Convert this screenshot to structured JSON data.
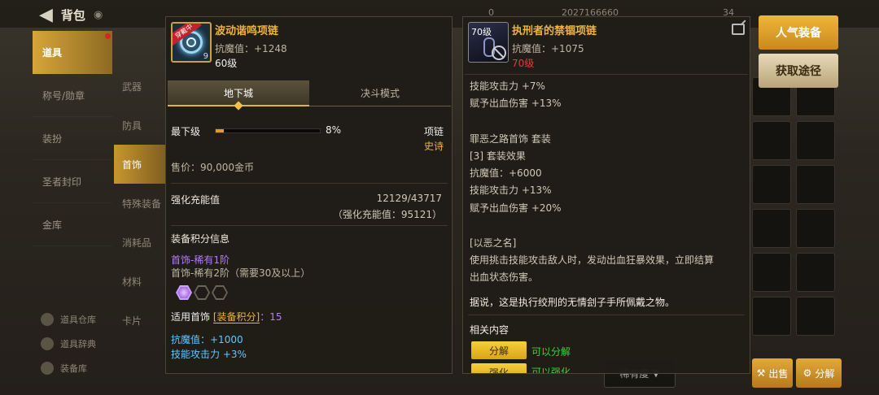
{
  "header": {
    "title": "背包",
    "stats": [
      "0",
      "2027166660",
      "34"
    ]
  },
  "leftnav": {
    "items": [
      {
        "label": "道具",
        "active": true
      },
      {
        "label": "称号/勋章",
        "active": false
      },
      {
        "label": "装扮",
        "active": false
      },
      {
        "label": "圣者封印",
        "active": false
      },
      {
        "label": "金库",
        "active": false
      }
    ]
  },
  "subnav": {
    "items": [
      {
        "label": "武器",
        "active": false
      },
      {
        "label": "防具",
        "active": false
      },
      {
        "label": "首饰",
        "active": true
      },
      {
        "label": "特殊装备",
        "active": false
      },
      {
        "label": "消耗品",
        "active": false
      },
      {
        "label": "材料",
        "active": false
      },
      {
        "label": "卡片",
        "active": false
      }
    ]
  },
  "bottom_left": [
    "道具仓库",
    "道具辞典",
    "装备库"
  ],
  "bottom_buttons": {
    "sell": "出售",
    "disassemble": "分解",
    "sort": "稀有度"
  },
  "left_panel": {
    "name": "波动谐鸣项链",
    "tag": "穿戴中",
    "icon_number": "9",
    "stat": "抗魔值：+1248",
    "level": "60级",
    "tabs": [
      {
        "label": "地下城",
        "active": true
      },
      {
        "label": "决斗模式",
        "active": false
      }
    ],
    "grade_label": "最下级",
    "grade_percent": "8%",
    "grade_fill": 0.08,
    "slot_label": "项链",
    "rarity": "史诗",
    "price": "售价：90,000金币",
    "charge_label": "强化充能值",
    "charge_value": "12129/43717",
    "charge_sub": "（强化充能值：95121）",
    "score_title": "装备积分信息",
    "score_line1": "首饰-稀有1阶",
    "score_line2": "首饰-稀有2阶（需要30及以上）",
    "apply_prefix": "适用首饰",
    "apply_bracket": "[装备积分]",
    "apply_value": "：15",
    "bonus1": "抗魔值：+1000",
    "bonus2": "技能攻击力 +3%"
  },
  "right_panel": {
    "icon_level": "70级",
    "name": "执刑者的禁锢项链",
    "stat": "抗魔值：+1075",
    "level": "70级",
    "lines": [
      "技能攻击力 +7%",
      "赋予出血伤害 +13%",
      "",
      "罪恶之路首饰  套装",
      "[3] 套装效果",
      "抗魔值：+6000",
      "技能攻击力 +13%",
      "赋予出血伤害 +20%",
      "",
      "[以恶之名]",
      "使用挑击技能攻击敌人时，发动出血狂暴效果，立即结算",
      "出血状态伤害。"
    ],
    "lore": "据说，这是执行绞刑的无情刽子手所佩戴之物。",
    "related_title": "相关内容",
    "btn1": "分解",
    "btn1_note": "可以分解",
    "btn2": "强化",
    "btn2_note": "可以强化"
  },
  "side_buttons": {
    "popular": "人气装备",
    "obtain": "获取途径"
  }
}
